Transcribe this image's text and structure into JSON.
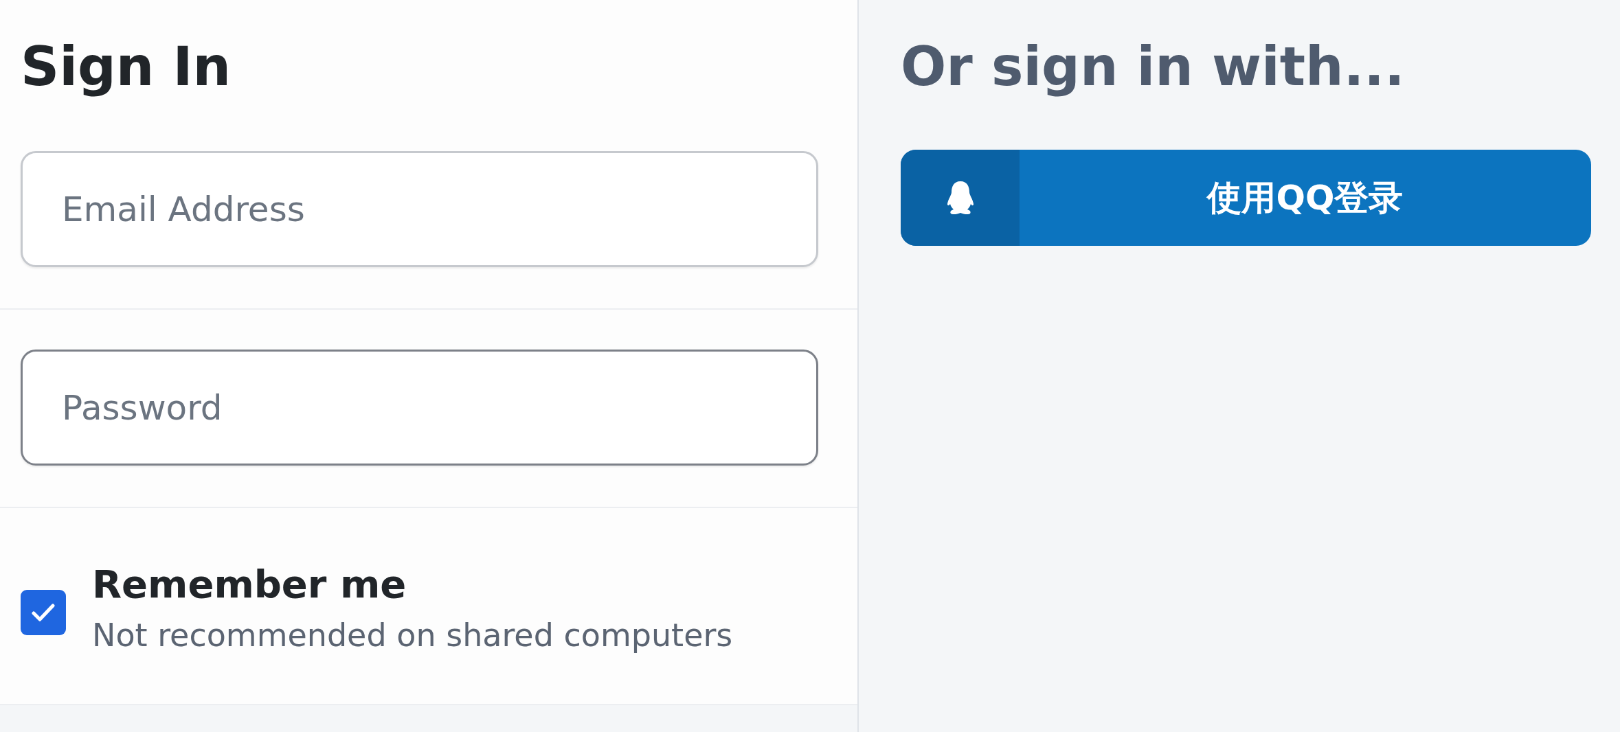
{
  "sign_in": {
    "title": "Sign In",
    "fields": [
      {
        "placeholder": "Email Address"
      },
      {
        "placeholder": "Password"
      }
    ],
    "remember": {
      "label": "Remember me",
      "hint": "Not recommended on shared computers",
      "checked": true
    }
  },
  "social": {
    "title": "Or sign in with...",
    "buttons": [
      {
        "label": "使用QQ登录"
      }
    ]
  }
}
